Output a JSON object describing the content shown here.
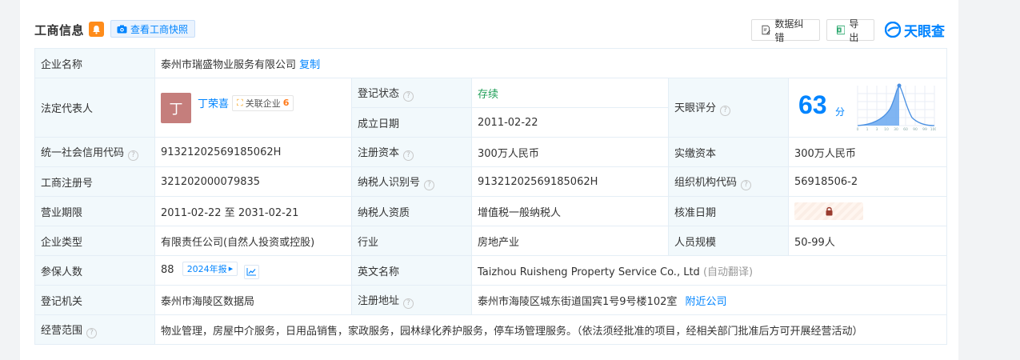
{
  "section": {
    "title": "工商信息",
    "snapshot_label": "查看工商快照",
    "correction_label": "数据纠错",
    "export_label": "导出",
    "logo_text": "天眼查"
  },
  "company": {
    "name_label": "企业名称",
    "name": "泰州市瑞盛物业服务有限公司",
    "copy_label": "复制"
  },
  "legal_rep": {
    "label": "法定代表人",
    "avatar_char": "丁",
    "name": "丁荣喜",
    "assoc_label": "关联企业",
    "assoc_count": "6"
  },
  "fields": {
    "reg_status_label": "登记状态",
    "reg_status": "存续",
    "found_date_label": "成立日期",
    "found_date": "2011-02-22",
    "score_label": "天眼评分",
    "score": "63",
    "score_unit": "分",
    "credit_code_label": "统一社会信用代码",
    "credit_code": "91321202569185062H",
    "reg_capital_label": "注册资本",
    "reg_capital": "300万人民币",
    "paid_capital_label": "实缴资本",
    "paid_capital": "300万人民币",
    "reg_no_label": "工商注册号",
    "reg_no": "321202000079835",
    "taxpayer_id_label": "纳税人识别号",
    "taxpayer_id": "91321202569185062H",
    "org_code_label": "组织机构代码",
    "org_code": "56918506-2",
    "term_label": "营业期限",
    "term": "2011-02-22 至 2031-02-21",
    "taxpayer_qual_label": "纳税人资质",
    "taxpayer_qual": "增值税一般纳税人",
    "approve_date_label": "核准日期",
    "company_type_label": "企业类型",
    "company_type": "有限责任公司(自然人投资或控股)",
    "industry_label": "行业",
    "industry": "房地产业",
    "staff_size_label": "人员规模",
    "staff_size": "50-99人",
    "insured_label": "参保人数",
    "insured": "88",
    "report_tag": "2024年报",
    "english_name_label": "英文名称",
    "english_name": "Taizhou Ruisheng Property Service Co., Ltd",
    "auto_translate": "(自动翻译)",
    "authority_label": "登记机关",
    "authority": "泰州市海陵区数据局",
    "address_label": "注册地址",
    "address": "泰州市海陵区城东街道国宾1号9号楼102室",
    "nearby_label": "附近公司",
    "scope_label": "经营范围",
    "scope": "物业管理，房屋中介服务，日用品销售，家政服务，园林绿化养护服务，停车场管理服务。（依法须经批准的项目，经相关部门批准后方可开展经营活动）"
  },
  "score_chart_ticks": [
    "0",
    "1",
    "3",
    "10",
    "30",
    "60",
    "90",
    "99",
    "100"
  ],
  "colors": {
    "accent": "#0084ff",
    "status_green": "#22a05a",
    "label_bg": "#f2f9fc"
  }
}
